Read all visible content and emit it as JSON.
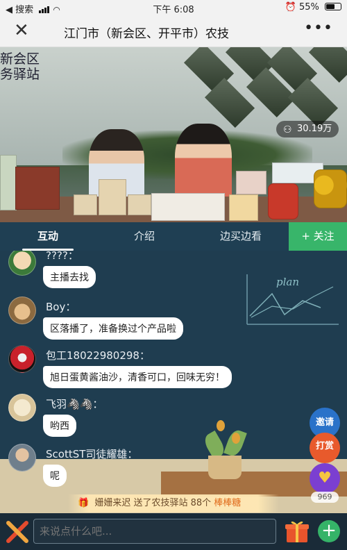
{
  "status_bar": {
    "back_label": "◀ 搜索",
    "time": "下午 6:08",
    "battery": "55%"
  },
  "nav": {
    "close_icon": "close-icon",
    "title": "江门市（新会区、开平市）农技",
    "more_icon": "more-icon"
  },
  "video": {
    "wall_text": "新会区 务驿站",
    "viewers": "30.19万"
  },
  "tabs": [
    {
      "label": "互动",
      "active": true
    },
    {
      "label": "介绍",
      "active": false
    },
    {
      "label": "边买边看",
      "active": false
    }
  ],
  "follow_label": "+ 关注",
  "decor_text": "plan",
  "messages": [
    {
      "user": "????：",
      "text": "主播去找"
    },
    {
      "user": "Boy：",
      "text": "区落播了，准备换过个产品啦"
    },
    {
      "user": "包工18022980298：",
      "text": "旭日蛋黄酱油沙，清香可口，回味无穷！"
    },
    {
      "user": "飞羽🦓🦓：",
      "text": "哟西"
    },
    {
      "user": "ScottST司徒耀雄：",
      "text": "呢"
    }
  ],
  "gift_banner": {
    "prefix": "姗姗来迟 送了农技驿站 88个",
    "gift_name": "棒棒糖"
  },
  "side_buttons": {
    "invite_label": "邀请",
    "reward_label": "打赏",
    "like_count": "969"
  },
  "input": {
    "placeholder": "来说点什么吧..."
  },
  "colors": {
    "follow_green": "#38b56a",
    "chat_bg": "#1f3d50",
    "heart_purple": "#7b3fd1"
  }
}
